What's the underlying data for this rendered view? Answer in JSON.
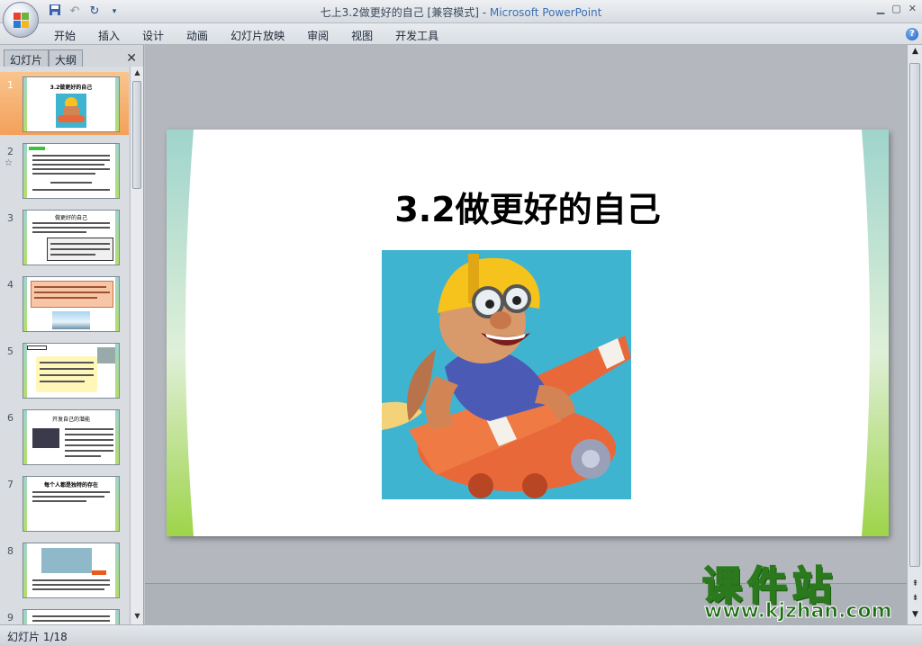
{
  "window": {
    "title_doc": "七上3.2做更好的自己 [兼容模式] - ",
    "title_app": "Microsoft PowerPoint"
  },
  "menu": [
    "开始",
    "插入",
    "设计",
    "动画",
    "幻灯片放映",
    "审阅",
    "视图",
    "开发工具"
  ],
  "left_pane": {
    "tab_slides": "幻灯片",
    "tab_outline": "大纲",
    "close_label": "✕",
    "slide_numbers": [
      "1",
      "2",
      "3",
      "4",
      "5",
      "6",
      "7",
      "8",
      "9"
    ],
    "thumb1_title": "3.2做更好的自己",
    "thumb3_title": "做更好的自己",
    "thumb6_title": "开发自己的潜能",
    "thumb7_title": "每个人都是独特的存在",
    "selected_slide": 1
  },
  "slide": {
    "title": "3.2做更好的自己"
  },
  "status": {
    "counter": "幻灯片 1/18"
  },
  "watermark": {
    "big": "课件站",
    "url": "www.kjzhan.com"
  },
  "colors": {
    "selected_thumb": "#f3a05a",
    "slide_accent_teal": "#9fd4cc",
    "slide_accent_green": "#b3df6a"
  }
}
